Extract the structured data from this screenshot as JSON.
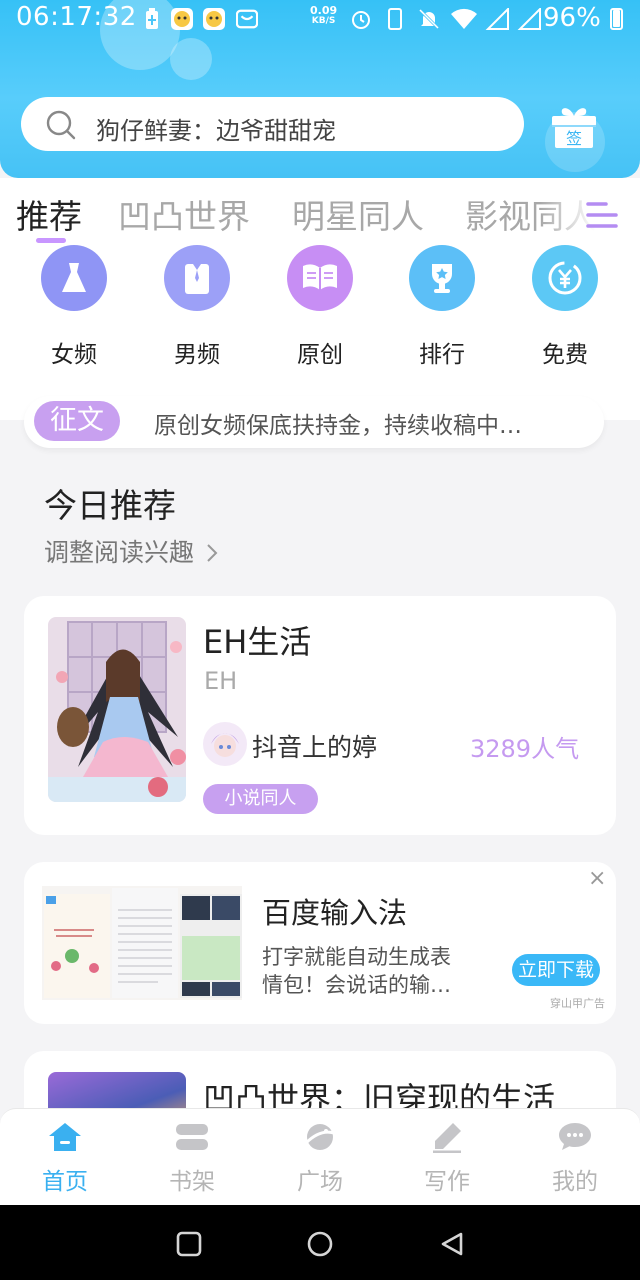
{
  "status_bar": {
    "time": "06:17:32",
    "net_speed_value": "0.09",
    "net_speed_unit": "KB/S",
    "battery": "96%",
    "icons": [
      "battery-saver-icon",
      "notification-app-icon",
      "notification-app-icon",
      "notification-box-icon",
      "alarm-icon",
      "phone-icon",
      "mute-icon",
      "wifi-icon",
      "signal-icon",
      "battery-icon"
    ]
  },
  "search": {
    "placeholder": "狗仔鲜妻：边爷甜甜宠"
  },
  "checkin": {
    "label": "签"
  },
  "tabs": [
    {
      "label": "推荐",
      "active": true
    },
    {
      "label": "凹凸世界",
      "active": false
    },
    {
      "label": "明星同人",
      "active": false
    },
    {
      "label": "影视同人",
      "active": false
    }
  ],
  "categories": [
    {
      "label": "女频",
      "icon": "dress-icon",
      "color": "#8f95f5"
    },
    {
      "label": "男频",
      "icon": "shirt-icon",
      "color": "#8f95f5"
    },
    {
      "label": "原创",
      "icon": "book-icon",
      "color": "#c78ef4"
    },
    {
      "label": "排行",
      "icon": "trophy-icon",
      "color": "#5cbff7"
    },
    {
      "label": "免费",
      "icon": "coin-icon",
      "color": "#5cc8f5"
    }
  ],
  "notice": {
    "badge": "征文",
    "text": "原创女频保底扶持金，持续收稿中…"
  },
  "today": {
    "title": "今日推荐",
    "subtitle": "调整阅读兴趣"
  },
  "featured_book": {
    "title": "EH生活",
    "author": "EH",
    "uploader": "抖音上的婷",
    "popularity": "3289人气",
    "tag": "小说同人"
  },
  "ad": {
    "title": "百度输入法",
    "desc_line1": "打字就能自动生成表",
    "desc_line2": "情包！会说话的输…",
    "button": "立即下载",
    "source": "穿山甲广告",
    "close": "×"
  },
  "next_book": {
    "title": "凹凸世界：旧穿现的生活"
  },
  "bottom_nav": [
    {
      "label": "首页",
      "icon": "home-icon",
      "active": true
    },
    {
      "label": "书架",
      "icon": "bookshelf-icon",
      "active": false
    },
    {
      "label": "广场",
      "icon": "planet-icon",
      "active": false
    },
    {
      "label": "写作",
      "icon": "pen-icon",
      "active": false
    },
    {
      "label": "我的",
      "icon": "chat-bubble-icon",
      "active": false
    }
  ],
  "colors": {
    "header_blue": "#3fc2f7",
    "accent_purple": "#c896ff",
    "nav_active": "#3ab0f0"
  }
}
